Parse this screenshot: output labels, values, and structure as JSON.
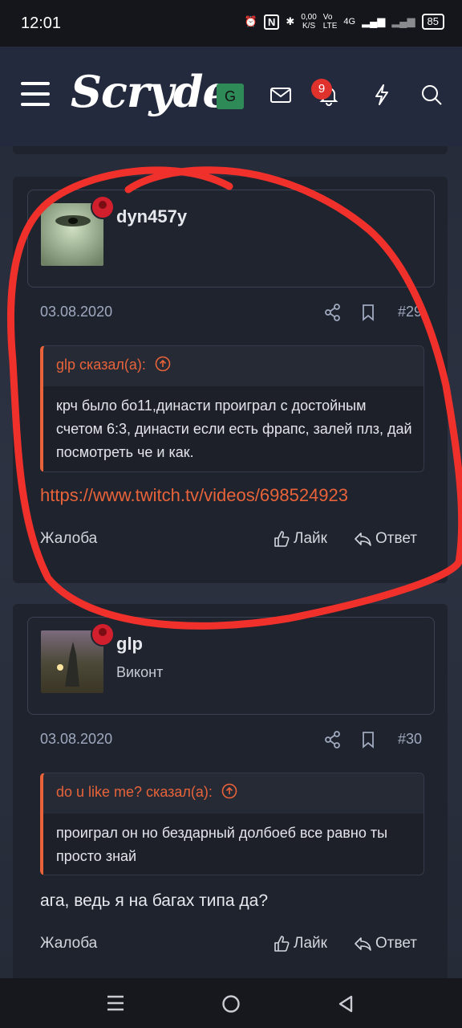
{
  "status_bar": {
    "time": "12:01",
    "net_speed_top": "0,00",
    "net_speed_bottom": "K/S",
    "volte_top": "Vo",
    "volte_bottom": "LTE",
    "network": "4G",
    "battery": "85"
  },
  "header": {
    "logo_text": "Scryde",
    "g_badge": "G",
    "notification_count": "9",
    "icons": [
      "menu-icon",
      "mail-icon",
      "bell-icon",
      "lightning-icon",
      "search-icon"
    ]
  },
  "posts": [
    {
      "username": "dyn457y",
      "user_title": "",
      "date": "03.08.2020",
      "post_number": "#29",
      "quote_author": "glp сказал(а):",
      "quote_text": "крч было бо11,династи проиграл с достойным счетом 6:3, династи если есть фрапс, залей плз, дай посмотреть че и как.",
      "link": "https://www.twitch.tv/videos/698524923",
      "report_label": "Жалоба",
      "like_label": "Лайк",
      "reply_label": "Ответ"
    },
    {
      "username": "glp",
      "user_title": "Виконт",
      "date": "03.08.2020",
      "post_number": "#30",
      "quote_author": "do u like me? сказал(а):",
      "quote_text": "проиграл он но бездарный долбоеб все равно ты просто знай",
      "body_text": "ага, ведь я на багах типа да?",
      "report_label": "Жалоба",
      "like_label": "Лайк",
      "reply_label": "Ответ"
    }
  ],
  "colors": {
    "accent": "#e8633a",
    "annotation_stroke": "#f0302b",
    "page_bg": "#1c2130",
    "card_bg": "#1f232d"
  }
}
